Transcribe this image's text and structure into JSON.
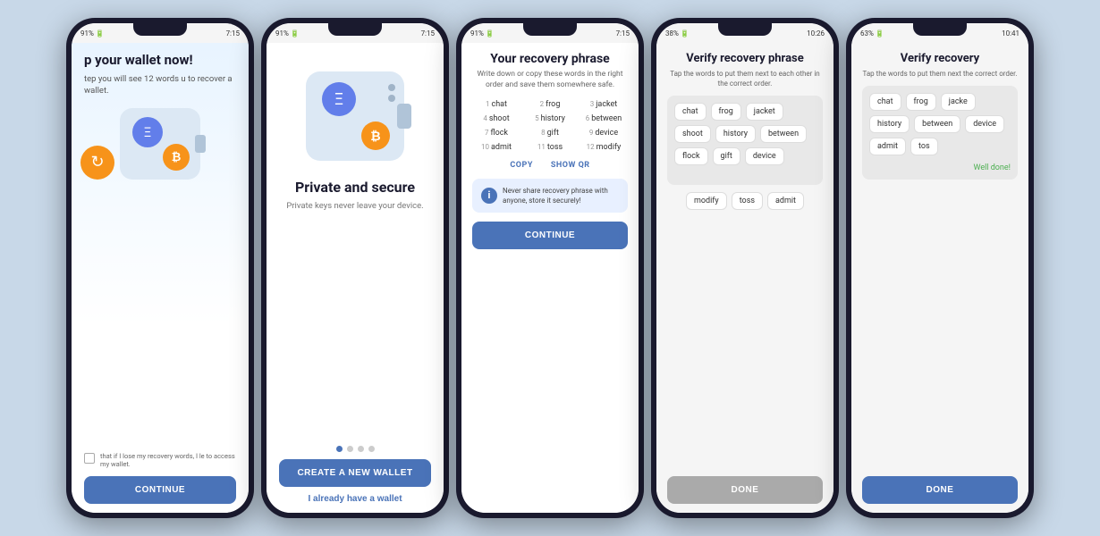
{
  "phones": [
    {
      "id": "phone1",
      "status": {
        "signal": "91%",
        "time": "7:15"
      },
      "title": "p your wallet now!",
      "description": "tep you will see 12 words\nu to recover a wallet.",
      "checkbox_text": "that if I lose my recovery words, I\nle to access my wallet.",
      "continue_btn": "CONTINUE"
    },
    {
      "id": "phone2",
      "status": {
        "signal": "91%",
        "time": "7:15"
      },
      "title": "Private and secure",
      "description": "Private keys never leave your device.",
      "dots": [
        "active",
        "inactive",
        "inactive",
        "inactive"
      ],
      "create_btn": "CREATE A NEW WALLET",
      "already_btn": "I already have a wallet"
    },
    {
      "id": "phone3",
      "status": {
        "signal": "91%",
        "time": "7:15"
      },
      "title": "Your recovery phrase",
      "subtitle": "Write down or copy these words in the right\norder and save them somewhere safe.",
      "words": [
        {
          "num": "1",
          "word": "chat"
        },
        {
          "num": "2",
          "word": "frog"
        },
        {
          "num": "3",
          "word": "jacket"
        },
        {
          "num": "4",
          "word": "shoot"
        },
        {
          "num": "5",
          "word": "history"
        },
        {
          "num": "6",
          "word": "between"
        },
        {
          "num": "7",
          "word": "flock"
        },
        {
          "num": "8",
          "word": "gift"
        },
        {
          "num": "9",
          "word": "device"
        },
        {
          "num": "10",
          "word": "admit"
        },
        {
          "num": "11",
          "word": "toss"
        },
        {
          "num": "12",
          "word": "modify"
        }
      ],
      "copy_btn": "COPY",
      "qr_btn": "SHOW QR",
      "warning": "Never share recovery phrase with anyone, store it securely!",
      "continue_btn": "CONTINUE"
    },
    {
      "id": "phone4",
      "status": {
        "signal": "38%",
        "time": "10:26"
      },
      "title": "Verify recovery phrase",
      "subtitle": "Tap the words to put them next to each other in\nthe correct order.",
      "selected_words": [
        "chat",
        "frog",
        "jacket",
        "shoot",
        "history",
        "between",
        "flock",
        "gift",
        "device"
      ],
      "available_words": [
        "modify",
        "toss",
        "admit"
      ],
      "done_btn": "DONE"
    },
    {
      "id": "phone5",
      "status": {
        "signal": "63%",
        "time": "10:41"
      },
      "title": "Verify recovery",
      "subtitle": "Tap the words to put them next\nthe correct order.",
      "selected_words_row1": [
        "chat",
        "frog",
        "jacke"
      ],
      "selected_words_row2": [
        "history",
        "between"
      ],
      "selected_words_row3": [
        "device",
        "admit",
        "tos"
      ],
      "well_done": "Well done!",
      "done_btn": "DONE"
    }
  ]
}
